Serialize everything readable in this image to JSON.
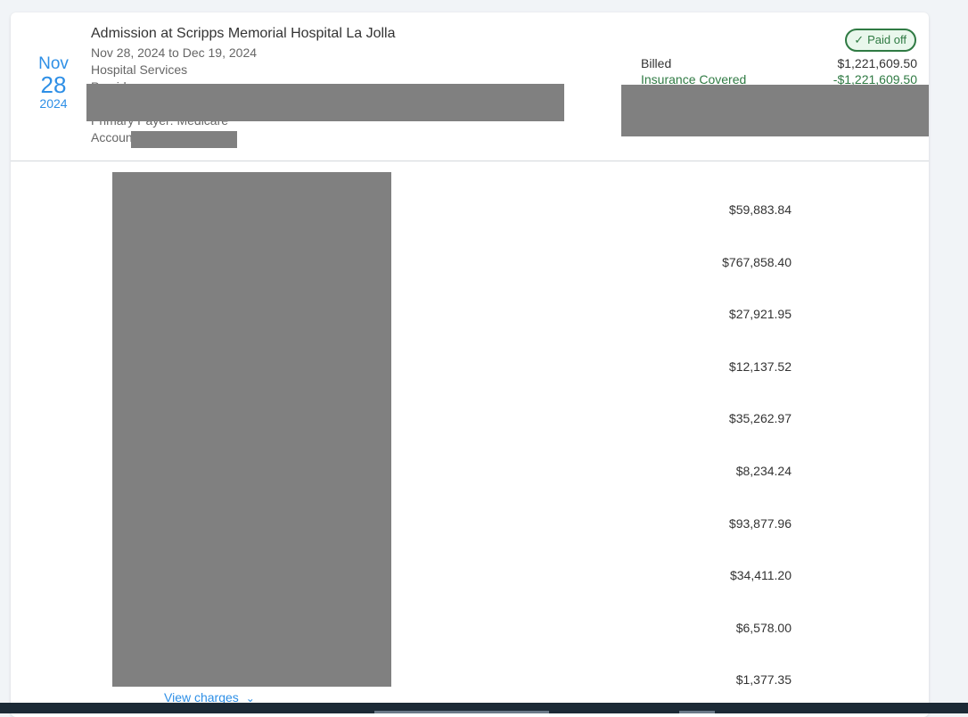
{
  "visit": {
    "month": "Nov",
    "day": "28",
    "year": "2024",
    "title": "Admission at Scripps Memorial Hospital La Jolla",
    "date_range": "Nov 28, 2024 to Dec 19, 2024",
    "service": "Hospital Services",
    "provider_partial": "Provider: ...",
    "primary_payer": "Primary Payer: Medicare",
    "account_label": "Accoun"
  },
  "status": {
    "label": "Paid off",
    "color": "#2f7a43"
  },
  "summary": {
    "billed_label": "Billed",
    "billed_value": "$1,221,609.50",
    "insurance_label": "Insurance Covered",
    "insurance_value": "-$1,221,609.50"
  },
  "charges": [
    "$59,883.84",
    "$767,858.40",
    "$27,921.95",
    "$12,137.52",
    "$35,262.97",
    "$8,234.24",
    "$93,877.96",
    "$34,411.20",
    "$6,578.00",
    "$1,377.35"
  ],
  "view_charges_label": "View charges",
  "colors": {
    "accent": "#2e8fe6",
    "success": "#2f7a43",
    "redaction": "#808080"
  }
}
